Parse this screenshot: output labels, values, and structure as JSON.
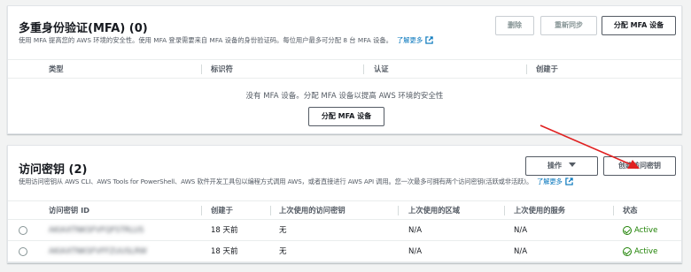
{
  "mfa": {
    "title": "多重身份验证(MFA) (0)",
    "description": "使用 MFA 提高您的 AWS 环境的安全性。使用 MFA 登录需要来自 MFA 设备的身份验证码。每位用户最多可分配 8 台 MFA 设备。",
    "learn_more": "了解更多",
    "buttons": {
      "delete": "删除",
      "resync": "重新同步",
      "assign": "分配 MFA 设备"
    },
    "columns": [
      "类型",
      "标识符",
      "认证",
      "创建于"
    ],
    "empty_message": "没有 MFA 设备。分配 MFA 设备以提高 AWS 环境的安全性",
    "empty_button": "分配 MFA 设备"
  },
  "access_keys": {
    "title": "访问密钥 (2)",
    "description": "使用访问密钥从 AWS CLI、AWS Tools for PowerShell、AWS 软件开发工具包以编程方式调用 AWS，或者直接进行 AWS API 调用。您一次最多可拥有两个访问密钥(活跃或非活跃)。",
    "learn_more": "了解更多",
    "buttons": {
      "actions": "操作",
      "create": "创建访问密钥"
    },
    "columns": [
      "访问密钥 ID",
      "创建于",
      "上次使用的访问密钥",
      "上次使用的区域",
      "上次使用的服务",
      "状态"
    ],
    "rows": [
      {
        "key_id": "AKIAXTNKSFVFQFSTRLUS",
        "created": "18 天前",
        "last_used": "无",
        "region": "N/A",
        "service": "N/A",
        "status": "Active"
      },
      {
        "key_id": "AKIAXTNKSFVFFZUUSLRW",
        "created": "18 天前",
        "last_used": "无",
        "region": "N/A",
        "service": "N/A",
        "status": "Active"
      }
    ]
  },
  "colors": {
    "link": "#0073bb",
    "active": "#1d8102",
    "annotation_arrow": "#e02020"
  }
}
